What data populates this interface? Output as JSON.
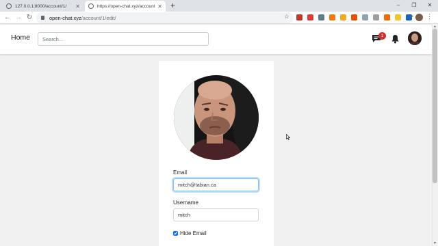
{
  "browser": {
    "tabs": [
      {
        "title": "127.0.0.1:8000/account/1/",
        "active": false
      },
      {
        "title": "https://open-chat.xyz/account/1/",
        "active": true
      }
    ],
    "new_tab": "+",
    "window_controls": [
      "–",
      "❐",
      "✕"
    ],
    "tab_close": "✕",
    "url_host": "open-chat.xyz",
    "url_path": "/account/1/edit/",
    "extension_colors": [
      "#c0392b",
      "#e53935",
      "#607d8b",
      "#f57c00",
      "#f9a825",
      "#e65100",
      "#90a4ae",
      "#9e9e9e",
      "#ef6c00",
      "#fbc02d",
      "#1565c0"
    ]
  },
  "header": {
    "home_label": "Home",
    "search_placeholder": "Search...",
    "chat_badge_count": "1",
    "accent_color": "#d32f2f"
  },
  "form": {
    "email_label": "Email",
    "email_value": "mitch@tabian.ca",
    "username_label": "Username",
    "username_value": "mitch",
    "hide_email_label": "Hide Email",
    "hide_email_checked": true
  }
}
